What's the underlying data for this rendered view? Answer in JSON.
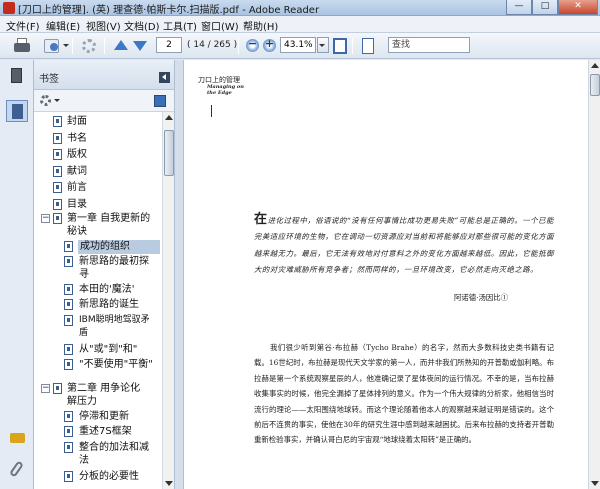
{
  "window": {
    "title": "[刀口上的管理]. (英) 理查德·帕斯卡尔.扫描版.pdf - Adobe Reader",
    "min": "—",
    "max": "□",
    "close": "✕"
  },
  "menu": [
    "文件(F)",
    "编辑(E)",
    "视图(V)",
    "文档(D)",
    "工具(T)",
    "窗口(W)",
    "帮助(H)"
  ],
  "toolbar": {
    "page_current": "2",
    "page_count": "( 14 / 265 )",
    "zoom_out": "−",
    "zoom_in": "+",
    "zoom": "43.1%",
    "search_placeholder": "查找"
  },
  "bookmarks_panel": {
    "title": "书签",
    "items": [
      {
        "label": "封面"
      },
      {
        "label": "书名"
      },
      {
        "label": "版权"
      },
      {
        "label": "献词"
      },
      {
        "label": "前言"
      },
      {
        "label": "目录"
      },
      {
        "label": "第一章 自我更新的\n秘诀",
        "expander": "−"
      },
      {
        "label": "成功的组织"
      },
      {
        "label": "新思路的最初探\n寻"
      },
      {
        "label": "本田的'魔法'"
      },
      {
        "label": "新思路的诞生"
      },
      {
        "label": "IBM聪明地驾驭矛\n盾"
      },
      {
        "label": "从\"或\"到\"和\""
      },
      {
        "label": "\"不要使用\"平衡\""
      },
      {
        "label": "第二章 用争论化\n解压力",
        "expander": "−"
      },
      {
        "label": "停滞和更新"
      },
      {
        "label": "重述7S框架"
      },
      {
        "label": "整合的加法和减\n法"
      },
      {
        "label": "分板的必要性"
      }
    ]
  },
  "document": {
    "header_cn": "刀口上的管理",
    "header_en": "Managing on the Edge",
    "epigraph_first": "在",
    "epigraph": "进化过程中，俗语说的“没有任何事情比成功更易失败”可能总是正确的。一个已能完美适应环境的生物，它在调动一切资源应对当前和将能够应对那些很可能的变化方面越来越无力。最后，它无法有效地对付意料之外的变化方面越来越低。因此，它能抵御大的对灾难威胁所有竞争者；然而同样的，一旦环境改变，它必然走向灭绝之路。",
    "attribution": "阿诺德·汤因比①",
    "body": "我们很少听到第谷·布拉赫（Tycho Brahe）的名字，然而大多数科技史类书籍有记载。16世纪时，布拉赫是现代天文学家的第一人，而并非我们所熟知的开普勒或伽利略。布拉赫是第一个系统观察星辰的人，他准确记录了星体夜间的运行情况。不幸的是，当布拉赫收集事实的时候，他完全漏掉了星体排列的意义。作为一个伟大规律的分析家，他相信当时流行的理论——太阳围绕地球转。而这个理论随着他本人的观察越来越证明是错误的。这个前后不连贯的事实，使他在30年的研究生涯中感到越来越困扰。后来布拉赫的支持者开普勒重新检验事实，并确认哥白尼的宇宙观“地球绕着太阳转”是正确的。"
  }
}
